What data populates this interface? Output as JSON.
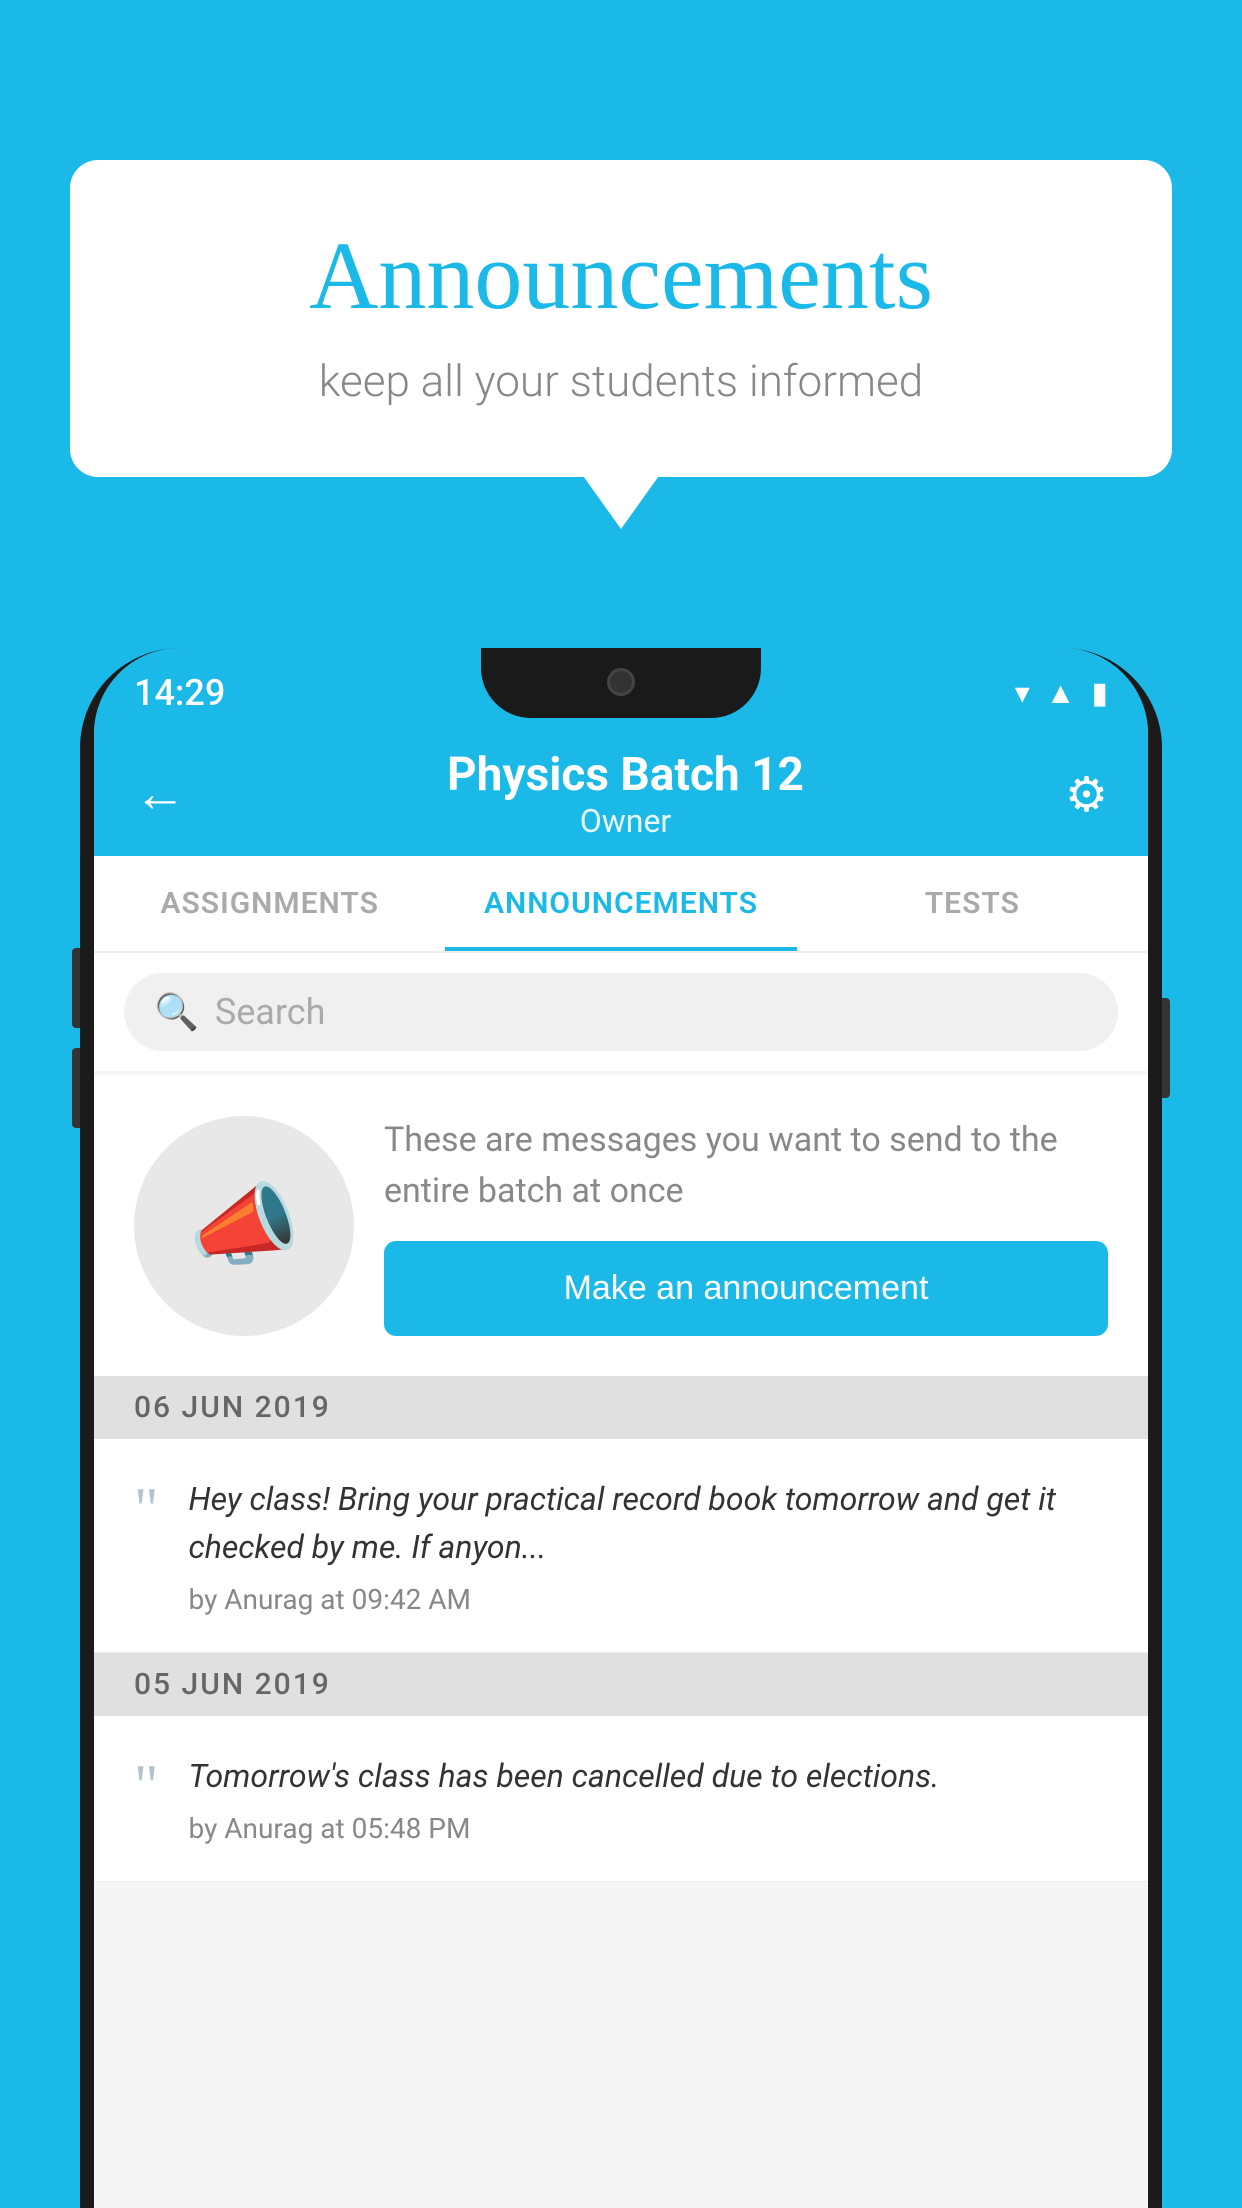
{
  "background_color": "#1ab9e8",
  "bubble": {
    "title": "Announcements",
    "subtitle": "keep all your students informed"
  },
  "phone": {
    "status_bar": {
      "time": "14:29"
    },
    "header": {
      "title": "Physics Batch 12",
      "subtitle": "Owner",
      "back_label": "←",
      "settings_label": "⚙"
    },
    "tabs": [
      {
        "label": "ASSIGNMENTS",
        "active": false
      },
      {
        "label": "ANNOUNCEMENTS",
        "active": true
      },
      {
        "label": "TESTS",
        "active": false
      }
    ],
    "search": {
      "placeholder": "Search"
    },
    "announcement_prompt": {
      "description": "These are messages you want to send to the entire batch at once",
      "button_label": "Make an announcement"
    },
    "announcements": [
      {
        "date": "06  JUN  2019",
        "text": "Hey class! Bring your practical record book tomorrow and get it checked by me. If anyon...",
        "meta": "by Anurag at 09:42 AM"
      },
      {
        "date": "05  JUN  2019",
        "text": "Tomorrow's class has been cancelled due to elections.",
        "meta": "by Anurag at 05:48 PM"
      }
    ]
  }
}
